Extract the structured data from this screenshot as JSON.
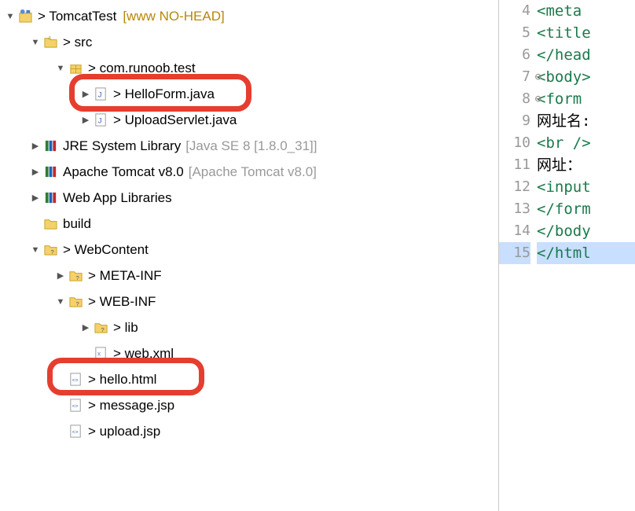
{
  "tree": {
    "project": {
      "name": "TomcatTest",
      "decorator": "[www NO-HEAD]",
      "prefix": "> "
    },
    "src": {
      "name": "src",
      "prefix": "> "
    },
    "pkg": {
      "name": "com.runoob.test",
      "prefix": "> "
    },
    "helloform": {
      "name": "HelloForm.java",
      "prefix": "> "
    },
    "uploadservlet": {
      "name": "UploadServlet.java",
      "prefix": "> "
    },
    "jre": {
      "name": "JRE System Library",
      "decorator": "[Java SE 8 [1.8.0_31]]"
    },
    "tomcat": {
      "name": "Apache Tomcat v8.0",
      "decorator": "[Apache Tomcat v8.0]"
    },
    "webapplibs": {
      "name": "Web App Libraries"
    },
    "build": {
      "name": "build"
    },
    "webcontent": {
      "name": "WebContent",
      "prefix": "> "
    },
    "metainf": {
      "name": "META-INF",
      "prefix": "> "
    },
    "webinf": {
      "name": "WEB-INF",
      "prefix": "> "
    },
    "lib": {
      "name": "lib",
      "prefix": "> "
    },
    "webxml": {
      "name": "web.xml",
      "prefix": "> "
    },
    "hellohtml": {
      "name": "hello.html",
      "prefix": "> "
    },
    "messagejsp": {
      "name": "message.jsp",
      "prefix": "> "
    },
    "uploadjsp": {
      "name": "upload.jsp",
      "prefix": "> "
    }
  },
  "editor": {
    "lines": [
      {
        "num": "4",
        "code": "<meta"
      },
      {
        "num": "5",
        "code": "<title"
      },
      {
        "num": "6",
        "code": "</head"
      },
      {
        "num": "7",
        "code": "<body>",
        "fold": true
      },
      {
        "num": "8",
        "code": "<form",
        "fold": true
      },
      {
        "num": "9",
        "code": "网址名:"
      },
      {
        "num": "10",
        "code": "<br />"
      },
      {
        "num": "11",
        "code": "网址："
      },
      {
        "num": "12",
        "code": "<input"
      },
      {
        "num": "13",
        "code": "</form"
      },
      {
        "num": "14",
        "code": "</body"
      },
      {
        "num": "15",
        "code": "</html",
        "hl": true
      }
    ]
  }
}
